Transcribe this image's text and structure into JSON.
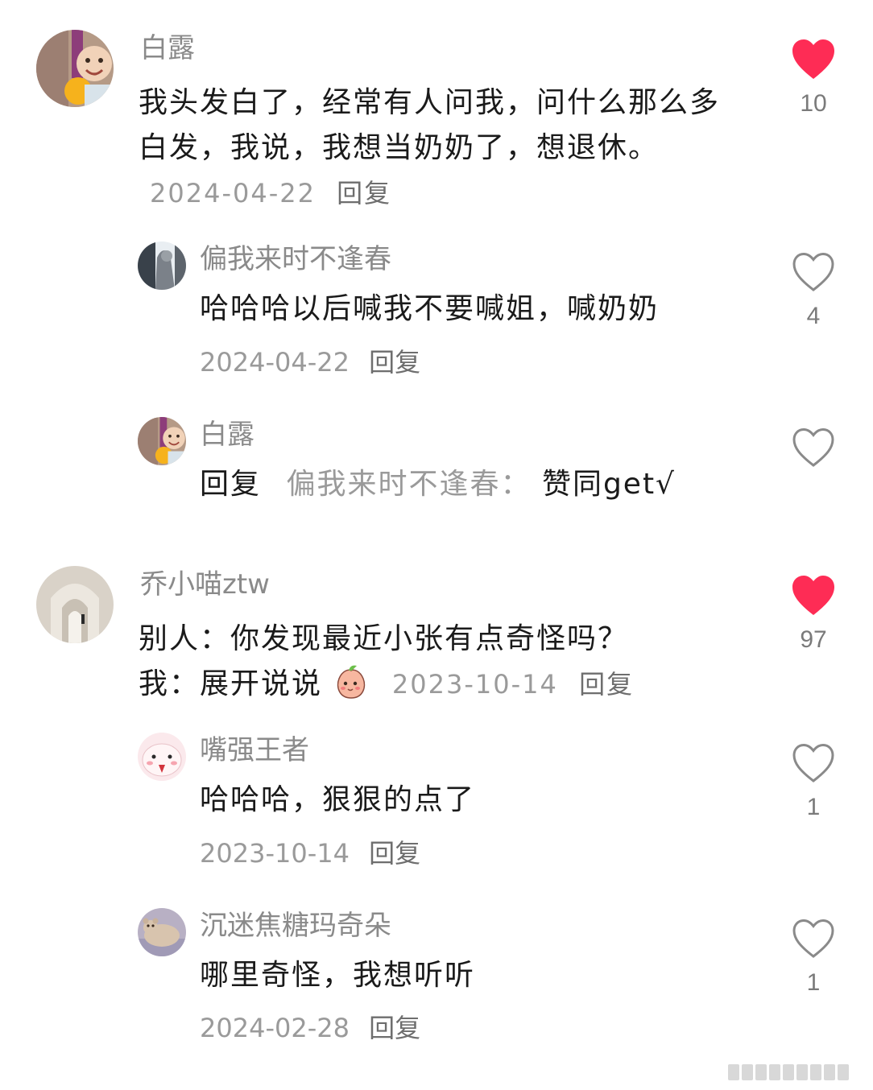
{
  "comments": [
    {
      "user": "白露",
      "text": "我头发白了，经常有人问我，问什么那么多白发，我说，我想当奶奶了，想退休。",
      "date": "2024-04-22",
      "reply_label": "回复",
      "likes": "10",
      "liked": true,
      "replies": [
        {
          "user": "偏我来时不逢春",
          "text": "哈哈哈以后喊我不要喊姐，喊奶奶",
          "date": "2024-04-22",
          "reply_label": "回复",
          "likes": "4",
          "liked": false
        },
        {
          "user": "白露",
          "reply_prefix": "回复",
          "reply_to": "偏我来时不逢春：",
          "text": "赞同get√",
          "likes": "",
          "liked": false
        }
      ]
    },
    {
      "user": "乔小喵ztw",
      "text_line1": "别人：你发现最近小张有点奇怪吗？",
      "text_line2": "我：展开说说",
      "date": "2023-10-14",
      "reply_label": "回复",
      "likes": "97",
      "liked": true,
      "replies": [
        {
          "user": "嘴强王者",
          "text": "哈哈哈，狠狠的点了",
          "date": "2023-10-14",
          "reply_label": "回复",
          "likes": "1",
          "liked": false
        },
        {
          "user": "沉迷焦糖玛奇朵",
          "text": "哪里奇怪，我想听听",
          "date": "2024-02-28",
          "reply_label": "回复",
          "likes": "1",
          "liked": false
        }
      ]
    }
  ],
  "colors": {
    "like_red": "#fe2c55",
    "outline": "#8a8a8a"
  },
  "icons": [
    "heart-filled-icon",
    "heart-outline-icon",
    "peach-emoji-icon"
  ]
}
